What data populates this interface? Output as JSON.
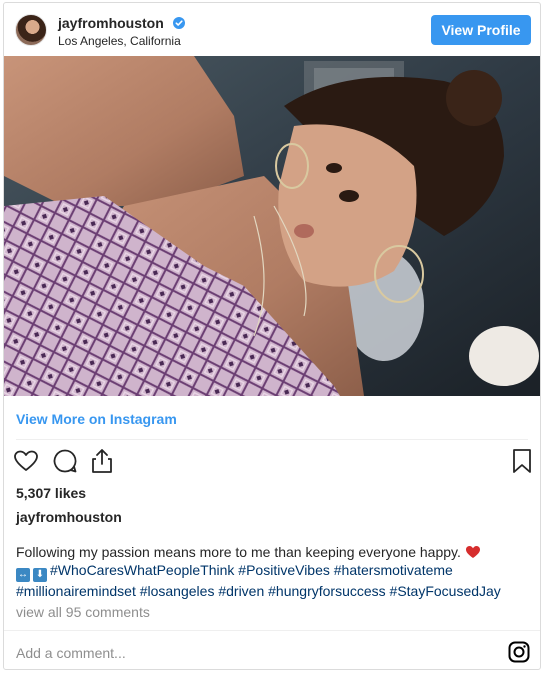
{
  "header": {
    "username": "jayfromhouston",
    "location": "Los Angeles, California",
    "view_profile_label": "View Profile"
  },
  "view_more_label": "View More on Instagram",
  "likes": "5,307 likes",
  "author": "jayfromhouston",
  "caption": {
    "text": "Following my passion means more to me than keeping everyone happy.",
    "emoji_1": "↔",
    "emoji_2": "⬇",
    "hashtags_line1": "#WhoCaresWhatPeopleThink #PositiveVibes #hatersmotivateme",
    "hashtags_line2": "#millionairemindset #losangeles #driven #hungryforsuccess #StayFocusedJay"
  },
  "comments_link": "view all 95 comments",
  "add_comment_placeholder": "Add a comment...",
  "colors": {
    "accent": "#3897f0",
    "heart": "#d62d2d"
  },
  "icons": [
    "verified-badge-icon",
    "heart-icon",
    "comment-icon",
    "share-icon",
    "bookmark-icon",
    "instagram-icon"
  ]
}
